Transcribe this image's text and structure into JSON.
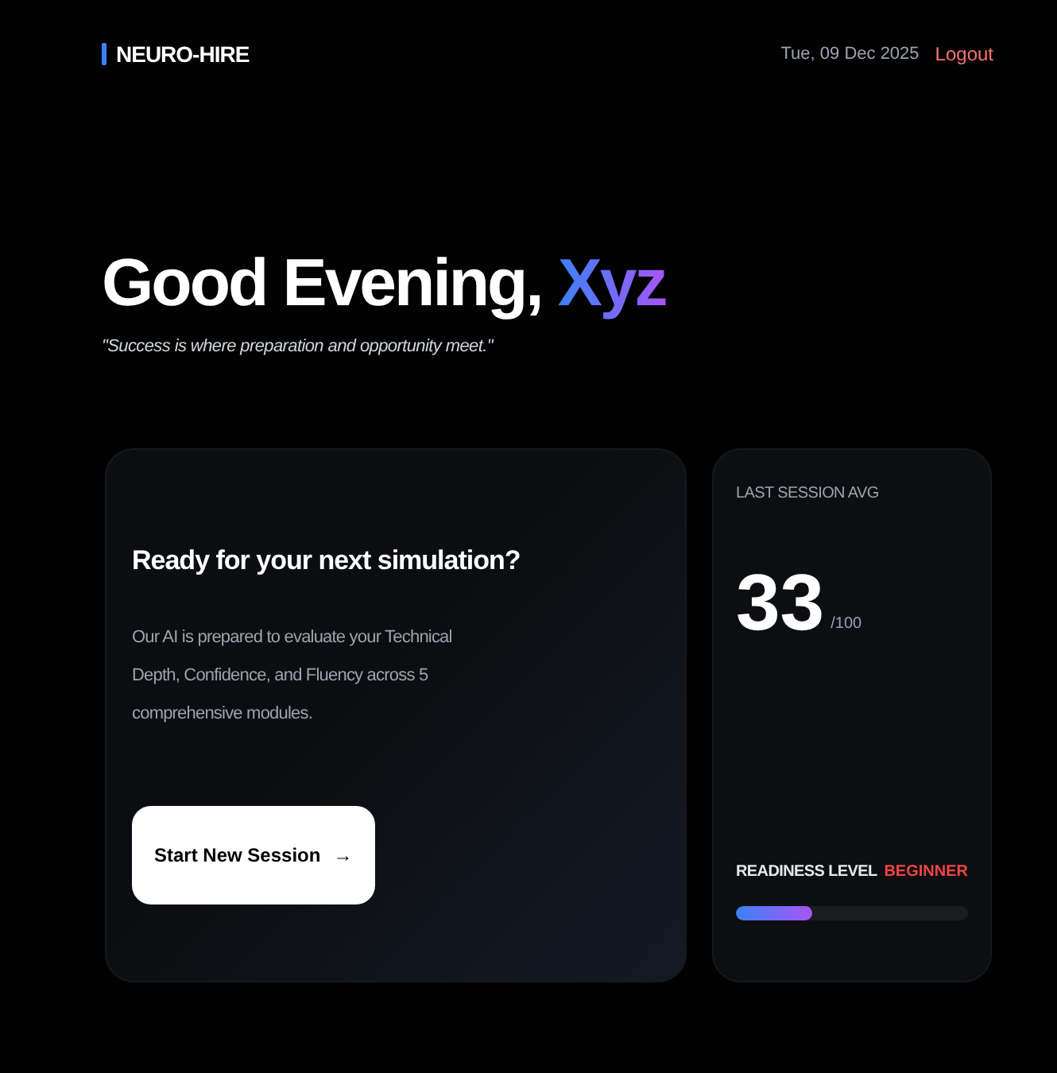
{
  "header": {
    "brand": "NEURO-HIRE",
    "date": "Tue, 09 Dec 2025",
    "logout": "Logout"
  },
  "greeting": {
    "text": "Good Evening,",
    "name": "Xyz",
    "quote": "\"Success is where preparation and opportunity meet.\""
  },
  "session_card": {
    "title": "Ready for your next simulation?",
    "body": "Our AI is prepared to evaluate your Technical Depth, Confidence, and Fluency across 5 comprehensive modules.",
    "button": "Start New Session",
    "button_icon": "→"
  },
  "stats_card": {
    "label": "LAST SESSION AVG",
    "score": "33",
    "out_of": "/100",
    "readiness_label": "READINESS LEVEL",
    "readiness_value": "BEGINNER",
    "level": 0.33
  }
}
